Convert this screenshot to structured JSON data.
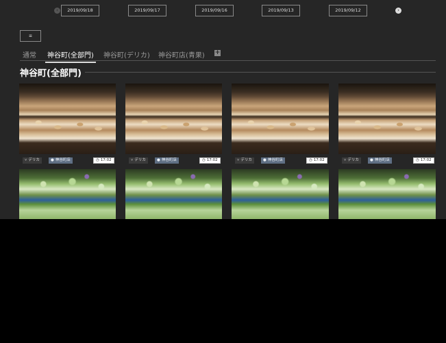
{
  "date_nav": {
    "prev_icon": "chevron-left-circle-icon",
    "next_icon": "chevron-right-circle-icon",
    "dates": [
      "2019/09/18",
      "2019/09/17",
      "2019/09/16",
      "2019/09/13",
      "2019/09/12"
    ]
  },
  "menu": {
    "label": "≡",
    "icon": "hamburger-menu-icon"
  },
  "tabs": [
    {
      "label": "通常",
      "active": false
    },
    {
      "label": "神谷町(全部門)",
      "active": true
    },
    {
      "label": "神谷町(デリカ)",
      "active": false
    },
    {
      "label": "神谷町店(青果)",
      "active": false
    }
  ],
  "add_tab": {
    "label": "+",
    "icon": "plus-square-icon"
  },
  "section": {
    "title": "神谷町(全部門)"
  },
  "cards": [
    {
      "photo": "bread",
      "category": "デリカ",
      "location": "神谷町店",
      "time": "17:02"
    },
    {
      "photo": "bread",
      "category": "デリカ",
      "location": "神谷町店",
      "time": "17:02"
    },
    {
      "photo": "bread",
      "category": "デリカ",
      "location": "神谷町店",
      "time": "17:02"
    },
    {
      "photo": "bread",
      "category": "デリカ",
      "location": "神谷町店",
      "time": "17:02"
    },
    {
      "photo": "vegetables"
    },
    {
      "photo": "vegetables"
    },
    {
      "photo": "vegetables"
    },
    {
      "photo": "vegetables"
    }
  ],
  "icons": {
    "category": "fork-knife-icon",
    "location": "map-pin-icon",
    "time": "clock-icon"
  },
  "colors": {
    "background": "#262626",
    "location_tag": "#5f6f84",
    "time_tag": "#ffffff"
  }
}
